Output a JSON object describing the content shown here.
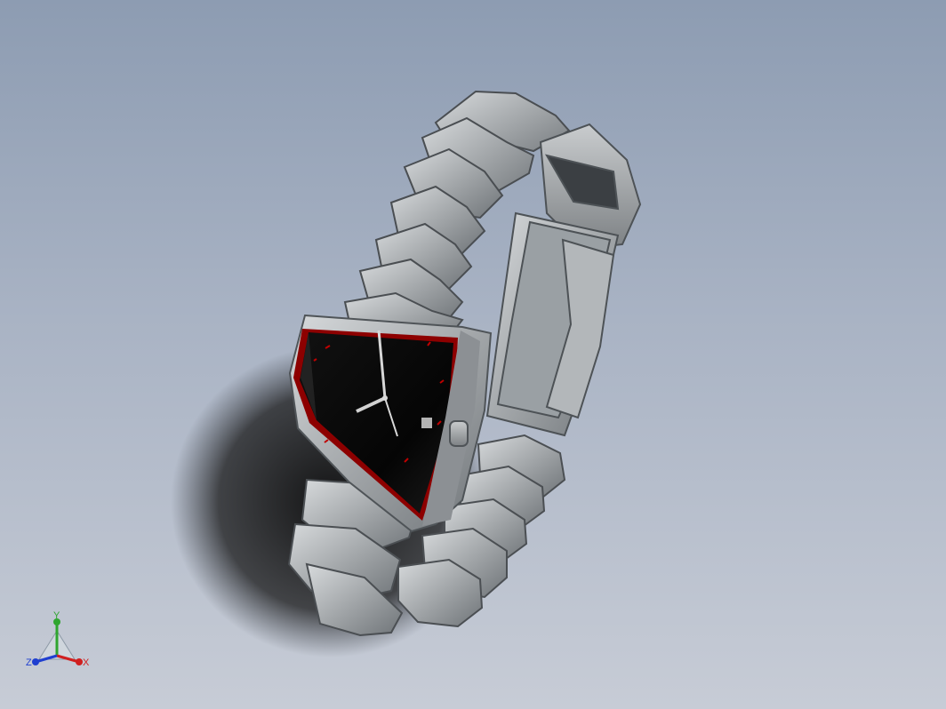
{
  "viewport": {
    "background_top": "#8d9cb2",
    "background_bottom": "#c7ccd6"
  },
  "model": {
    "subject": "wristwatch",
    "metal_color": "#9fa3a6",
    "dial_color": "#050505",
    "accent_color": "#c00000"
  },
  "triad": {
    "x_label": "X",
    "y_label": "Y",
    "z_label": "Z",
    "x_color": "#d01f1f",
    "y_color": "#2fa52f",
    "z_color": "#1f3fd0"
  }
}
